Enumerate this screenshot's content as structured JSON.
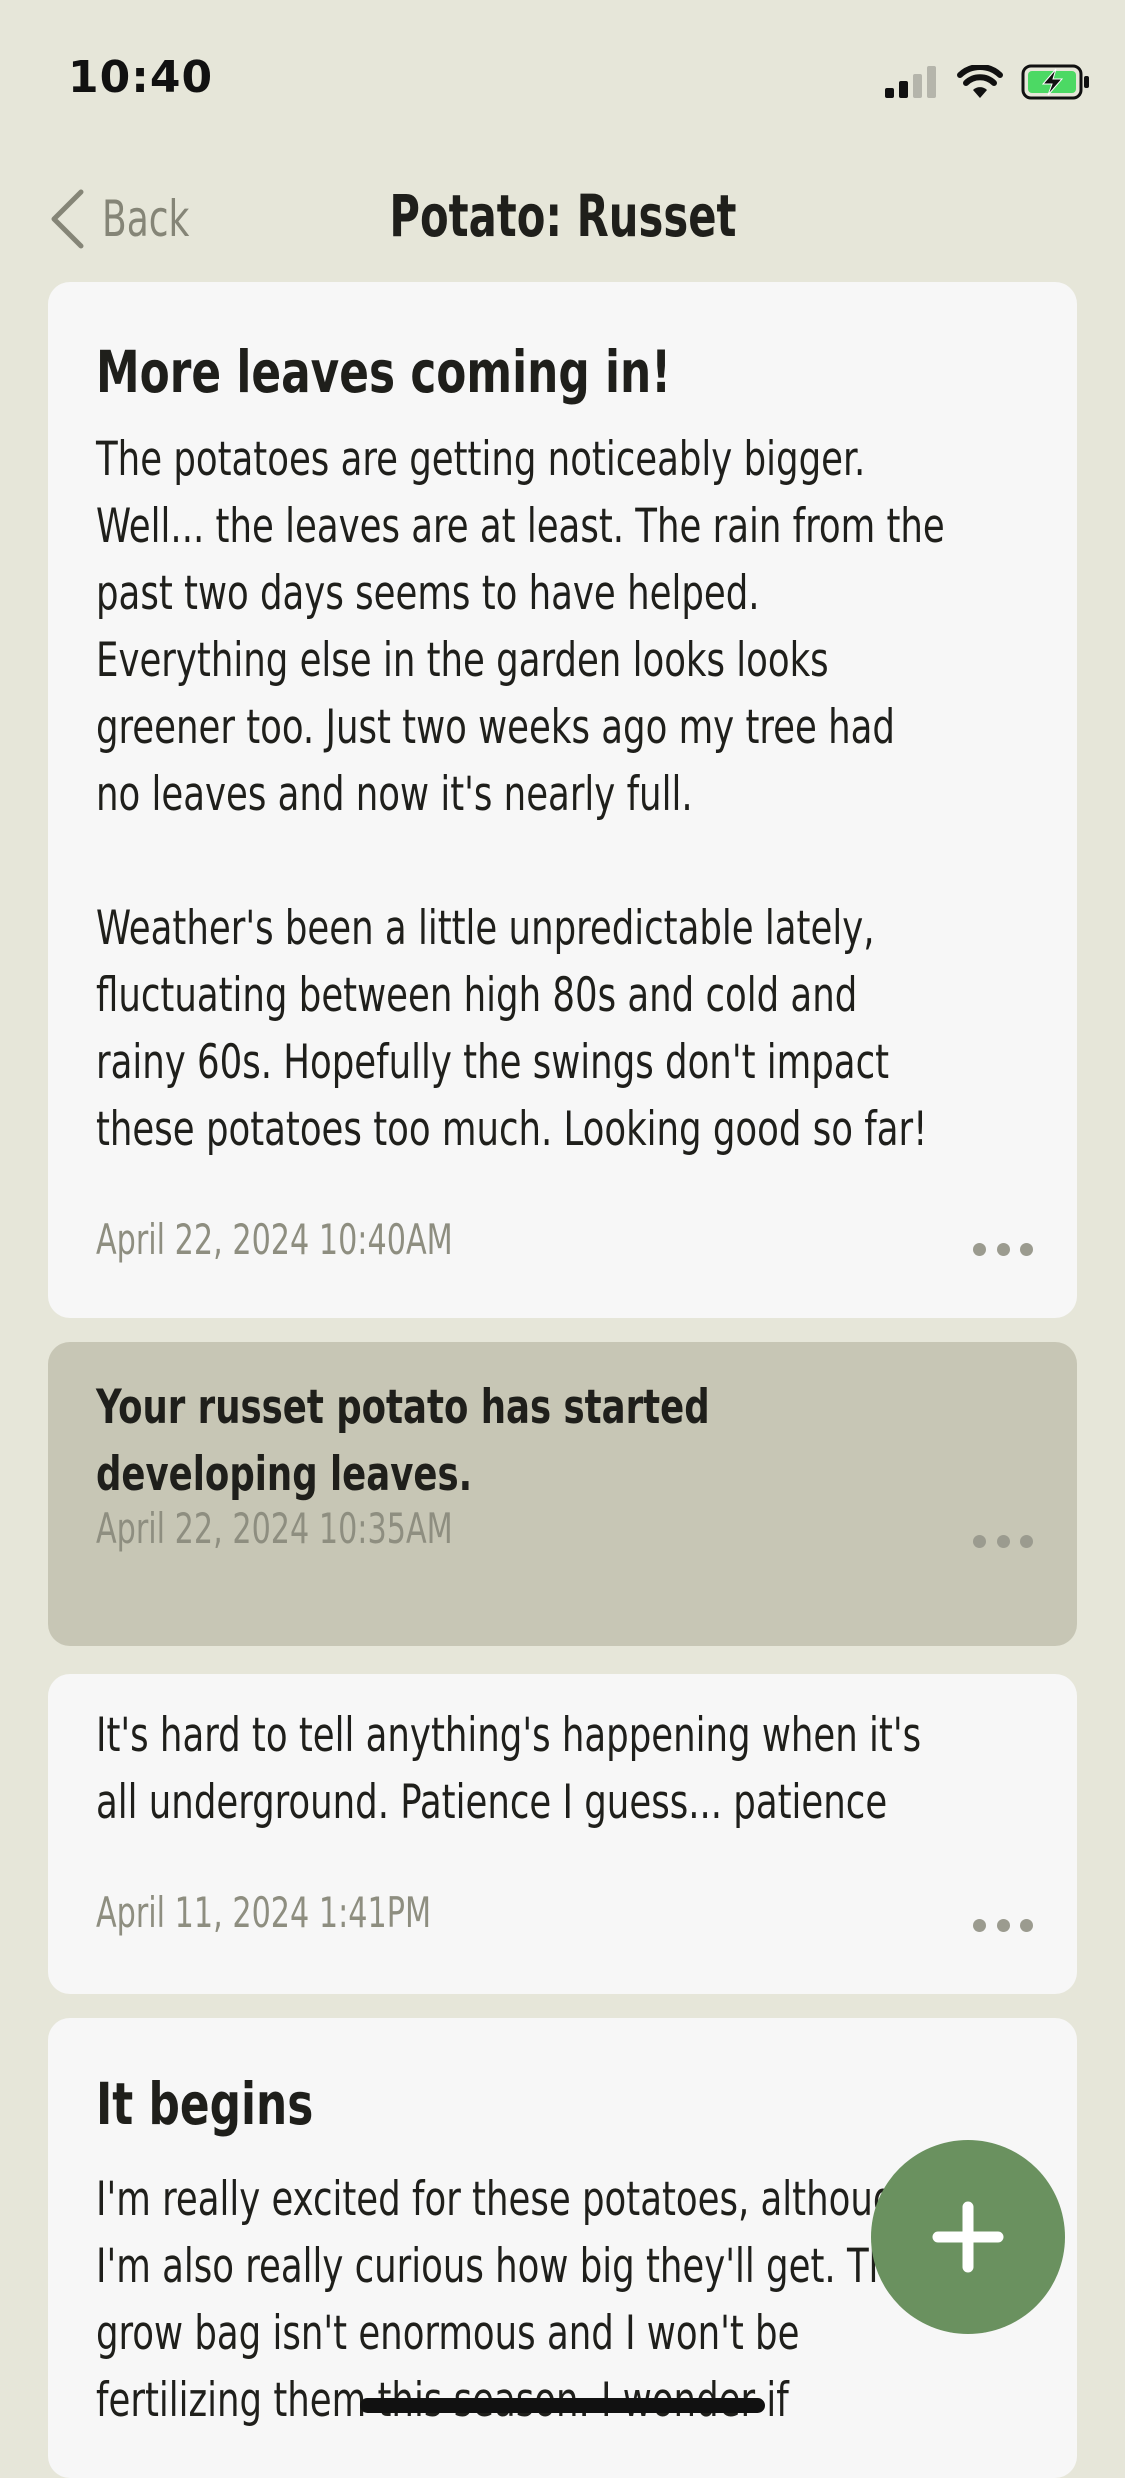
{
  "status_bar": {
    "time": "10:40",
    "icons": [
      "cellular-signal-icon",
      "wifi-icon",
      "battery-charging-icon"
    ],
    "battery_color": "#4cd964"
  },
  "nav": {
    "back_label": "Back",
    "title": "Potato: Russet"
  },
  "entries": [
    {
      "type": "journal",
      "title": "More leaves coming in!",
      "body": "The potatoes are getting noticeably bigger.\nWell... the leaves are at least. The rain from the\npast two days seems to have helped.\nEverything else in the garden looks looks\ngreener too. Just two weeks ago my tree had\nno leaves and now it's nearly full.\n\nWeather's been a little unpredictable lately,\nfluctuating between high 80s and cold and\nrainy 60s. Hopefully the swings don't impact\nthese potatoes too much. Looking good so far!",
      "date": "April 22, 2024 10:40AM"
    },
    {
      "type": "system",
      "text": "Your russet potato has started\ndeveloping leaves.",
      "date": "April 22, 2024 10:35AM"
    },
    {
      "type": "journal",
      "body": "It's hard to tell anything's happening when it's\nall underground. Patience I guess... patience",
      "date": "April 11, 2024 1:41PM"
    },
    {
      "type": "journal",
      "title": "It begins",
      "body": "I'm really excited for these potatoes, although\nI'm also really curious how big they'll get. The\ngrow bag isn't enormous and I won't be\nfertilizing them this season. I wonder if"
    }
  ],
  "fab": {
    "icon": "plus-icon",
    "color": "#6a915f"
  },
  "colors": {
    "background": "#e6e6d9",
    "card": "#f7f7f7",
    "system_card": "#c7c6b5",
    "muted_text": "#8e8e80"
  }
}
